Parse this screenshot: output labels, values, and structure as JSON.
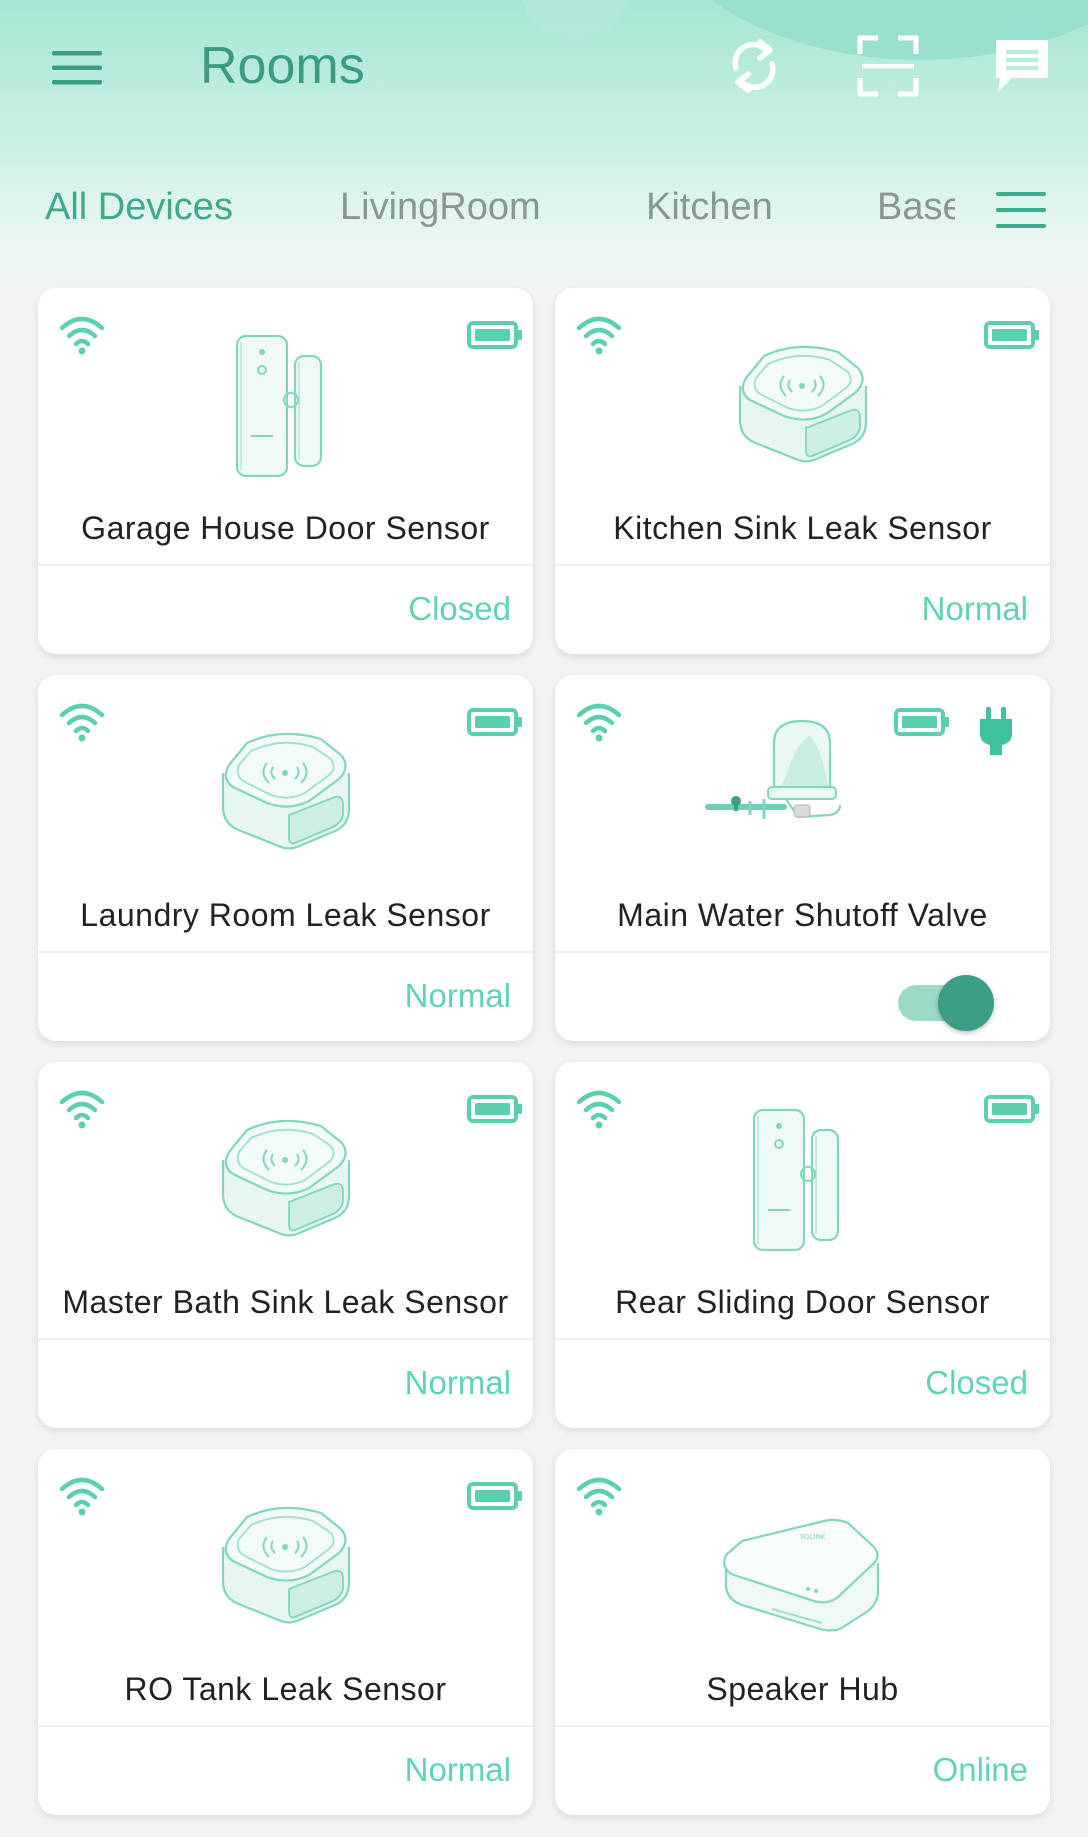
{
  "header": {
    "title": "Rooms",
    "icons": {
      "menu": "hamburger-menu-icon",
      "refresh": "refresh-icon",
      "scan": "scan-frame-icon",
      "messages": "message-icon"
    }
  },
  "tabs": {
    "items": [
      {
        "label": "All Devices",
        "active": true
      },
      {
        "label": "LivingRoom",
        "active": false
      },
      {
        "label": "Kitchen",
        "active": false
      },
      {
        "label": "Base",
        "active": false
      }
    ],
    "list_icon": "list-menu-icon"
  },
  "colors": {
    "accent": "#3fa88d",
    "status": "#5fd4b4",
    "icon": "#5ccfae",
    "toggle_knob": "#3d9e86"
  },
  "devices": [
    {
      "name": "Garage House Door Sensor",
      "status": "Closed",
      "icon": "door-sensor-icon"
    },
    {
      "name": "Kitchen Sink Leak Sensor",
      "status": "Normal",
      "icon": "leak-sensor-icon"
    },
    {
      "name": "Laundry Room Leak Sensor",
      "status": "Normal",
      "icon": "leak-sensor-icon"
    },
    {
      "name": "Main Water Shutoff Valve",
      "status": "",
      "toggle_on": true,
      "icon": "valve-controller-icon"
    },
    {
      "name": "Master Bath Sink Leak Sensor",
      "status": "Normal",
      "icon": "leak-sensor-icon"
    },
    {
      "name": "Rear Sliding Door Sensor",
      "status": "Closed",
      "icon": "door-sensor-icon"
    },
    {
      "name": "RO Tank Leak Sensor",
      "status": "Normal",
      "icon": "leak-sensor-icon"
    },
    {
      "name": "Speaker Hub",
      "status": "Online",
      "icon": "speaker-hub-icon"
    }
  ]
}
